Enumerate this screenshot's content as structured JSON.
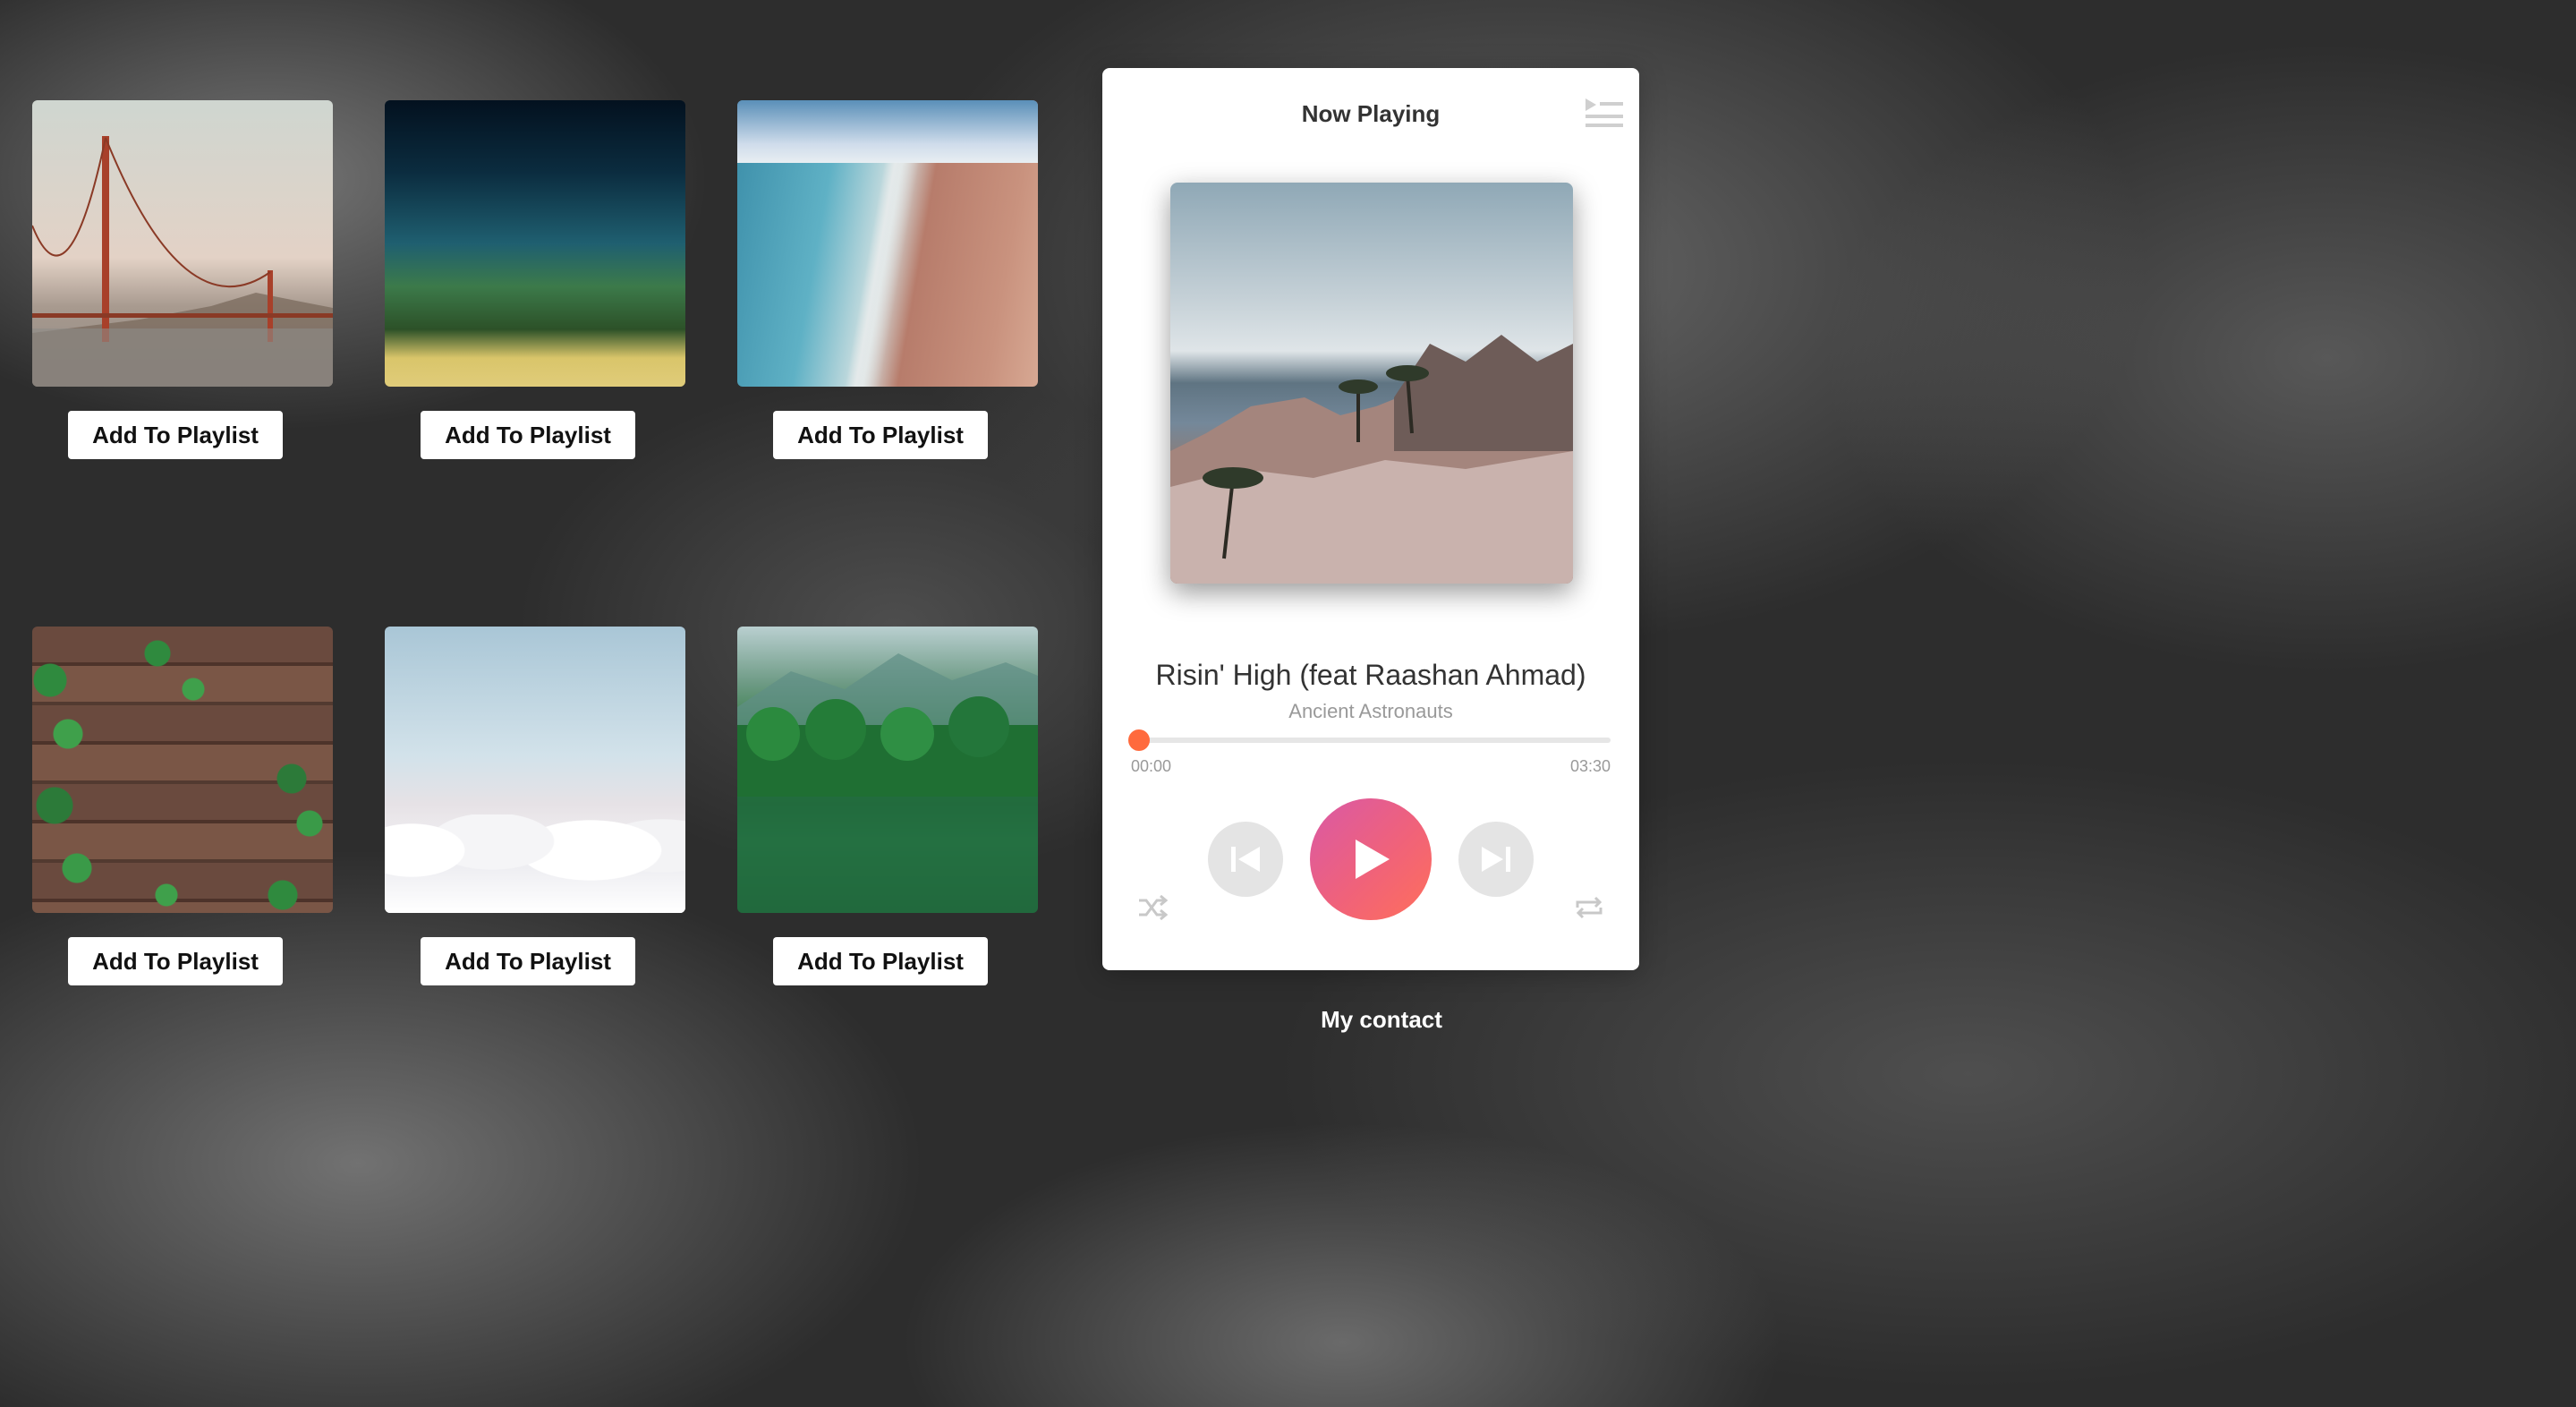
{
  "gallery": {
    "items": [
      {
        "button_label": "Add To Playlist"
      },
      {
        "button_label": "Add To Playlist"
      },
      {
        "button_label": "Add To Playlist"
      },
      {
        "button_label": "Add To Playlist"
      },
      {
        "button_label": "Add To Playlist"
      },
      {
        "button_label": "Add To Playlist"
      }
    ]
  },
  "player": {
    "header_title": "Now Playing",
    "playlist_icon": "playlist-icon",
    "song_title": "Risin' High (feat Raashan Ahmad)",
    "artist": "Ancient Astronauts",
    "time_current": "00:00",
    "time_total": "03:30",
    "progress_fraction": 0.02,
    "accent_color": "#ff6a3d",
    "play_gradient": [
      "#d959a6",
      "#ff6f5a"
    ],
    "controls": {
      "shuffle_icon": "shuffle-icon",
      "previous_icon": "previous-icon",
      "play_icon": "play-icon",
      "next_icon": "next-icon",
      "repeat_icon": "repeat-icon"
    }
  },
  "footer": {
    "contact_label": "My contact"
  }
}
